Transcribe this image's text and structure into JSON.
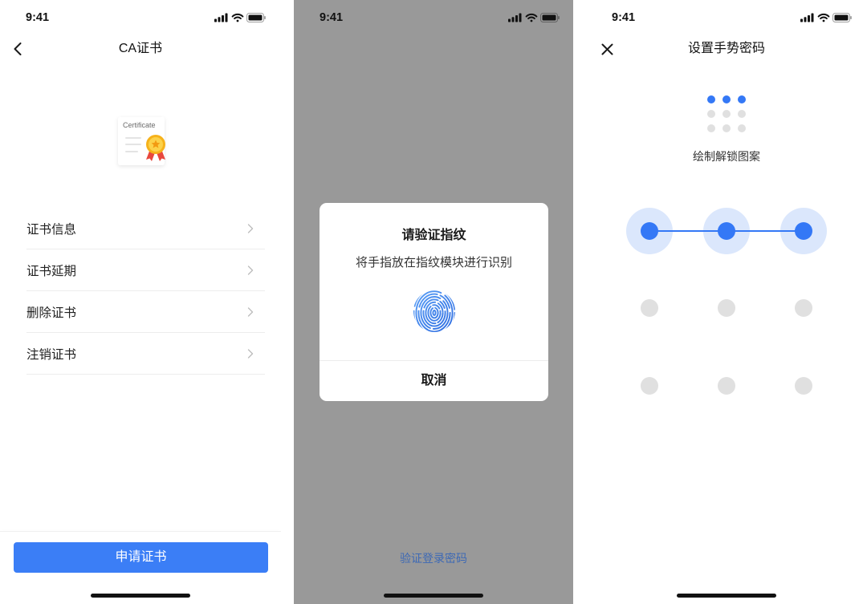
{
  "colors": {
    "accent": "#3b7ef6",
    "pattern_active": "#3478f6",
    "pattern_halo": "#dbe7fc",
    "pattern_idle": "#e0e0e0",
    "overlay": "#999999",
    "link": "#3d69b5"
  },
  "screens": [
    {
      "status_bar": {
        "time": "9:41",
        "icons": [
          "signal-icon",
          "wifi-icon",
          "battery-icon"
        ]
      },
      "nav": {
        "left_icon": "back-icon",
        "title": "CA证书"
      },
      "certificate": {
        "icon": "certificate-icon",
        "caption": "Certificate"
      },
      "menu": [
        {
          "label": "证书信息",
          "icon": "chevron-right-icon"
        },
        {
          "label": "证书延期",
          "icon": "chevron-right-icon"
        },
        {
          "label": "删除证书",
          "icon": "chevron-right-icon"
        },
        {
          "label": "注销证书",
          "icon": "chevron-right-icon"
        }
      ],
      "primary_button": {
        "label": "申请证书"
      }
    },
    {
      "status_bar": {
        "time": "9:41",
        "icons": [
          "signal-icon",
          "wifi-icon",
          "battery-icon"
        ]
      },
      "dialog": {
        "title": "请验证指纹",
        "message": "将手指放在指纹模块进行识别",
        "icon": "fingerprint-icon",
        "cancel_label": "取消"
      },
      "footer_link": {
        "label": "验证登录密码"
      }
    },
    {
      "status_bar": {
        "time": "9:41",
        "icons": [
          "signal-icon",
          "wifi-icon",
          "battery-icon"
        ]
      },
      "nav": {
        "left_icon": "close-icon",
        "title": "设置手势密码"
      },
      "preview": {
        "selected": [
          1,
          2,
          3
        ]
      },
      "hint": "绘制解锁图案",
      "pattern": {
        "path": [
          1,
          2,
          3
        ]
      }
    }
  ]
}
